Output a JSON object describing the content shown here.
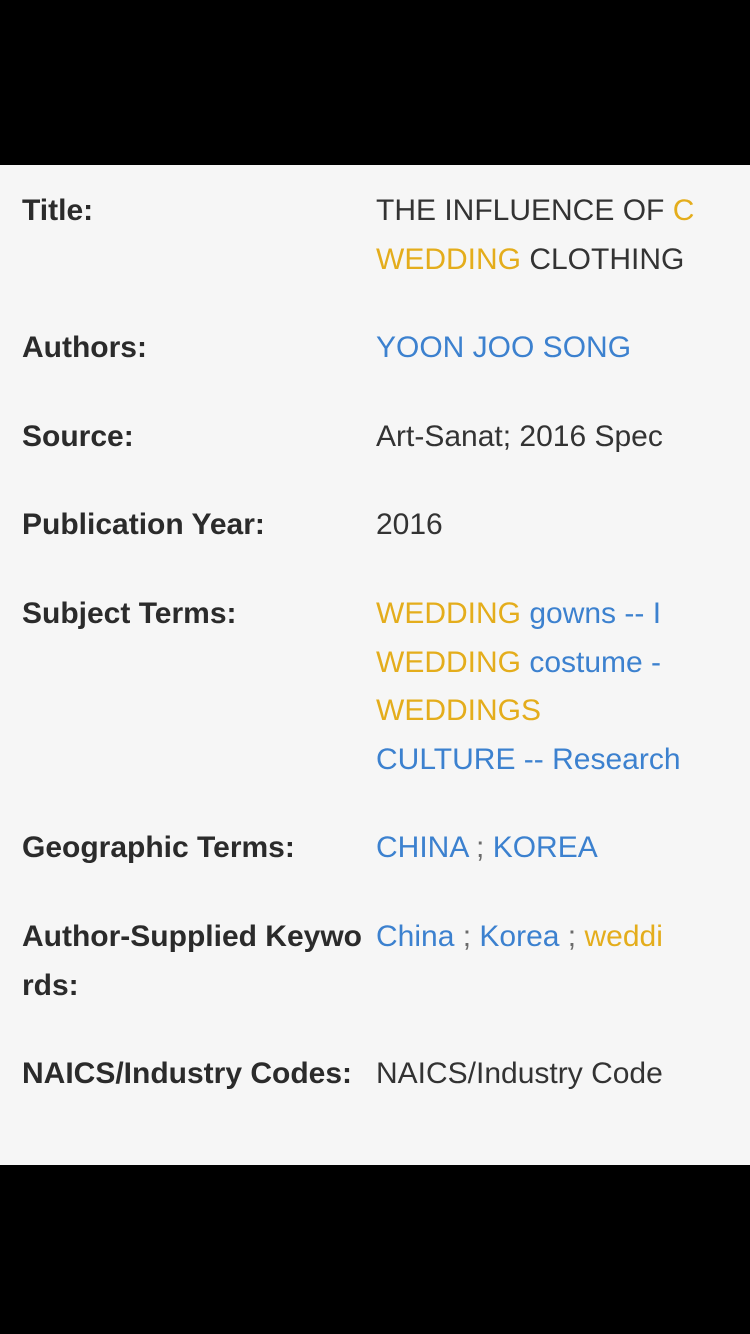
{
  "colors": {
    "background": "#f6f6f6",
    "letterbox": "#000000",
    "label": "#2b2b2b",
    "plain_text": "#333333",
    "link_blue": "#3c81cf",
    "term_gold": "#e4ad1c",
    "separator": "#6b6b6b"
  },
  "record": {
    "rows": [
      {
        "id": "title",
        "label": "Title:",
        "lines": [
          [
            {
              "text": "THE INFLUENCE OF ",
              "style": "plain"
            },
            {
              "text": "C",
              "style": "term"
            }
          ],
          [
            {
              "text": "WEDDING",
              "style": "term"
            },
            {
              "text": " CLOTHING",
              "style": "plain"
            }
          ]
        ]
      },
      {
        "id": "authors",
        "label": "Authors:",
        "lines": [
          [
            {
              "text": "YOON JOO SONG",
              "style": "link"
            }
          ]
        ]
      },
      {
        "id": "source",
        "label": "Source:",
        "lines": [
          [
            {
              "text": "Art-Sanat; 2016 Spec",
              "style": "plain"
            }
          ]
        ]
      },
      {
        "id": "publication-year",
        "label": "Publication Year:",
        "lines": [
          [
            {
              "text": "2016",
              "style": "plain"
            }
          ]
        ]
      },
      {
        "id": "subject-terms",
        "label": "Subject Terms:",
        "lines": [
          [
            {
              "text": "WEDDING",
              "style": "term"
            },
            {
              "text": " gowns -- ",
              "style": "link"
            },
            {
              "text": "I",
              "style": "link"
            }
          ],
          [
            {
              "text": "WEDDING",
              "style": "term"
            },
            {
              "text": " costume -",
              "style": "link"
            }
          ],
          [
            {
              "text": "WEDDINGS",
              "style": "term"
            }
          ],
          [
            {
              "text": "CULTURE -- Research",
              "style": "link"
            }
          ]
        ]
      },
      {
        "id": "geographic-terms",
        "label": "Geographic Terms:",
        "lines": [
          [
            {
              "text": "CHINA",
              "style": "link"
            },
            {
              "text": " ; ",
              "style": "sep"
            },
            {
              "text": "KOREA",
              "style": "link"
            }
          ]
        ]
      },
      {
        "id": "author-supplied-keywords",
        "label": "Author-Supplied Keywords:",
        "lines": [
          [
            {
              "text": "China",
              "style": "link"
            },
            {
              "text": " ; ",
              "style": "sep"
            },
            {
              "text": "Korea",
              "style": "link"
            },
            {
              "text": " ; ",
              "style": "sep"
            },
            {
              "text": "weddi",
              "style": "term"
            }
          ]
        ]
      },
      {
        "id": "naics-industry-codes",
        "label": "NAICS/Industry Codes:",
        "lines": [
          [
            {
              "text": "NAICS/Industry Code",
              "style": "plain"
            }
          ]
        ]
      }
    ]
  }
}
